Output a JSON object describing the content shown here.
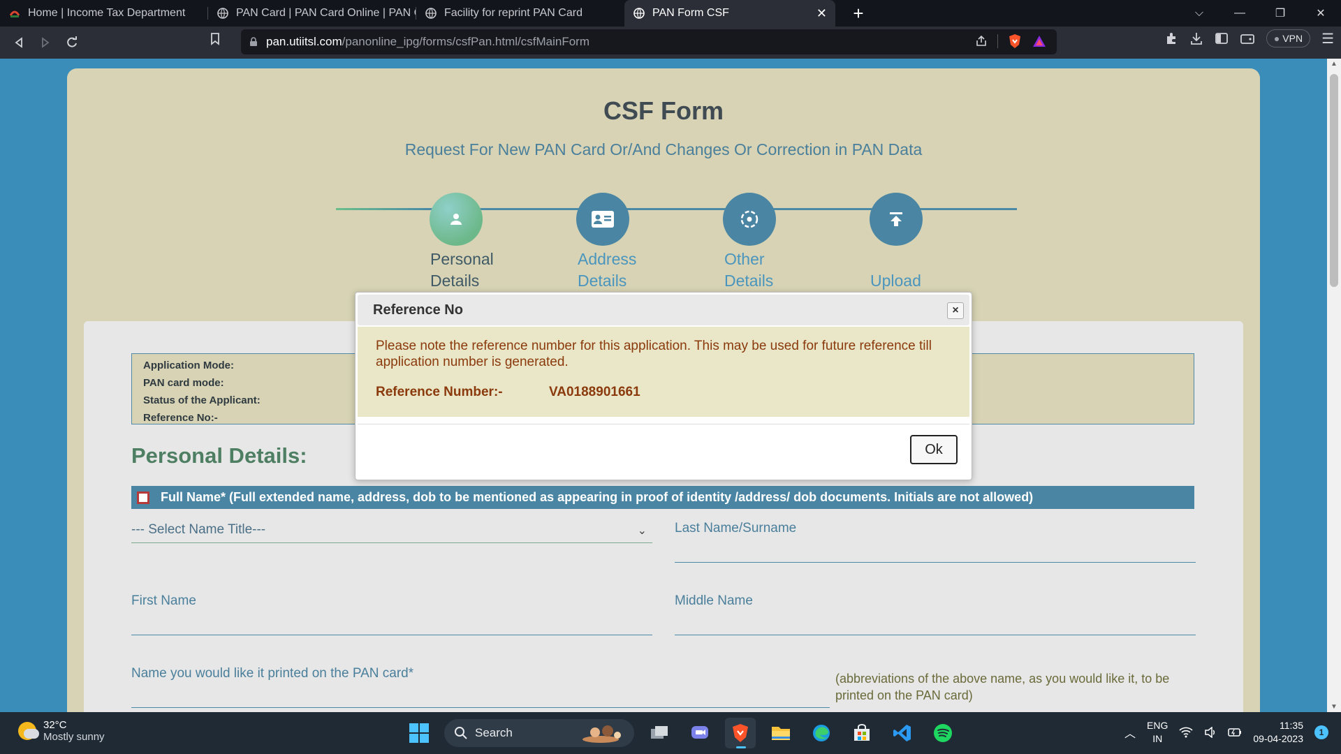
{
  "browser": {
    "tabs": [
      {
        "title": "Home | Income Tax Department",
        "active": false
      },
      {
        "title": "PAN Card | PAN Card Online | PAN Car",
        "active": false
      },
      {
        "title": "Facility for reprint PAN Card",
        "active": false
      },
      {
        "title": "PAN Form CSF",
        "active": true
      }
    ],
    "url_host": "pan.utiitsl.com",
    "url_path": "/panonline_ipg/forms/csfPan.html/csfMainForm",
    "vpn_label": "VPN"
  },
  "form": {
    "title": "CSF Form",
    "subtitle": "Request For New PAN Card Or/And Changes Or Correction in PAN Data",
    "steps": [
      {
        "line1": "Personal",
        "line2": "Details",
        "active": true
      },
      {
        "line1": "Address",
        "line2": "Details",
        "active": false
      },
      {
        "line1": "Other",
        "line2": "Details",
        "active": false
      },
      {
        "line1": "",
        "line2": "Upload",
        "active": false
      }
    ],
    "info": {
      "application_mode": "Application Mode:",
      "pan_card_mode": "PAN card mode:",
      "status": "Status of the Applicant:",
      "reference_no": "Reference No:-"
    },
    "personal_details_title": "Personal Details:",
    "fullname_bar": "Full Name* (Full extended name, address, dob to be mentioned as appearing in proof of identity /address/ dob documents. Initials are not allowed)",
    "name_title_select": "--- Select Name Title---",
    "last_name_label": "Last Name/Surname",
    "first_name_label": "First Name",
    "middle_name_label": "Middle Name",
    "print_name_label": "Name you would like it printed on the PAN card*",
    "abbr_note": "(abbreviations of the above name, as you would like it, to be printed on the PAN card)"
  },
  "modal": {
    "title": "Reference No",
    "close": "×",
    "message": "Please note the reference number for this application. This may be used for future reference till application number is generated.",
    "ref_label": "Reference Number:-",
    "ref_value": "VA0188901661",
    "ok_label": "Ok"
  },
  "taskbar": {
    "temperature": "32°C",
    "weather": "Mostly sunny",
    "search_label": "Search",
    "lang_line1": "ENG",
    "lang_line2": "IN",
    "time": "11:35",
    "date": "09-04-2023",
    "notification_count": "1"
  },
  "colors": {
    "page_bg": "#3a8db8",
    "form_bg": "#d7d3b4",
    "accent": "#4a86a3",
    "modal_text": "#8a3a0c"
  }
}
